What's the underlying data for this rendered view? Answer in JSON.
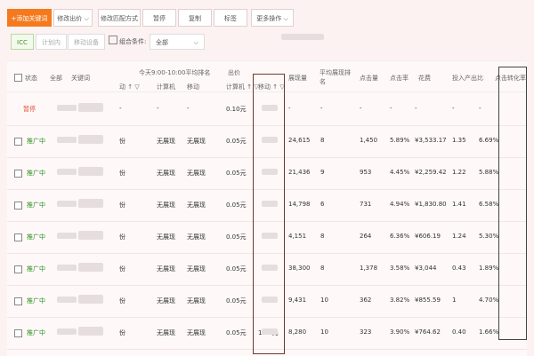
{
  "toolbar": {
    "add_keyword": "+添加关键词",
    "modify_bid": "修改出价",
    "modify_match": "修改匹配方式",
    "pause": "暂停",
    "copy": "复制",
    "tag": "标签",
    "more": "更多操作"
  },
  "filter": {
    "tabs": [
      "ICC",
      "计划内",
      "移动设备"
    ],
    "condition_label": "组合条件:",
    "condition_value": "全部"
  },
  "table": {
    "headers": {
      "status": "状态",
      "all": "全部",
      "keyword": "关键词",
      "rank_group": "今天9:00-10:00平均排名",
      "rank_mobile_left": "动 ↑ ▽",
      "rank_pc": "计算机",
      "rank_mobile": "移动",
      "bid_group": "出价",
      "bid_pc": "计算机 ↑ ▽",
      "bid_mobile": "移动 ↑ ▽",
      "impressions": "展现量",
      "avg_rank": "平均展现排名",
      "clicks": "点击量",
      "ctr": "点击率",
      "cost": "花费",
      "roi": "投入产出比",
      "conv": "点击转化率"
    },
    "rows": [
      {
        "status": "暂停",
        "status_type": "pause",
        "rank_mobile_left": "-",
        "rank_pc": "-",
        "rank_mobile": "-",
        "bid_pc": "0.10元",
        "bid_mobile": "",
        "impressions": "-",
        "avg_rank": "-",
        "clicks": "-",
        "ctr": "-",
        "cost": "-",
        "roi": "-",
        "conv": "-"
      },
      {
        "status": "推广中",
        "status_type": "on",
        "rank_mobile_left": "份",
        "rank_pc": "无展现",
        "rank_mobile": "无展现",
        "bid_pc": "0.05元",
        "bid_mobile": "",
        "impressions": "24,615",
        "avg_rank": "8",
        "clicks": "1,450",
        "ctr": "5.89%",
        "cost": "¥3,533.17",
        "roi": "1.35",
        "conv": "6.69%"
      },
      {
        "status": "推广中",
        "status_type": "on",
        "rank_mobile_left": "份",
        "rank_pc": "无展现",
        "rank_mobile": "无展现",
        "bid_pc": "0.05元",
        "bid_mobile": "",
        "impressions": "21,436",
        "avg_rank": "9",
        "clicks": "953",
        "ctr": "4.45%",
        "cost": "¥2,259.42",
        "roi": "1.22",
        "conv": "5.88%"
      },
      {
        "status": "推广中",
        "status_type": "on",
        "rank_mobile_left": "份",
        "rank_pc": "无展现",
        "rank_mobile": "无展现",
        "bid_pc": "0.05元",
        "bid_mobile": "",
        "impressions": "14,798",
        "avg_rank": "6",
        "clicks": "731",
        "ctr": "4.94%",
        "cost": "¥1,830.80",
        "roi": "1.41",
        "conv": "6.58%"
      },
      {
        "status": "推广中",
        "status_type": "on",
        "rank_mobile_left": "份",
        "rank_pc": "无展现",
        "rank_mobile": "无展现",
        "bid_pc": "0.05元",
        "bid_mobile": "",
        "impressions": "4,151",
        "avg_rank": "8",
        "clicks": "264",
        "ctr": "6.36%",
        "cost": "¥606.19",
        "roi": "1.24",
        "conv": "5.30%"
      },
      {
        "status": "推广中",
        "status_type": "on",
        "rank_mobile_left": "份",
        "rank_pc": "无展现",
        "rank_mobile": "无展现",
        "bid_pc": "0.05元",
        "bid_mobile": "",
        "impressions": "38,300",
        "avg_rank": "8",
        "clicks": "1,378",
        "ctr": "3.58%",
        "cost": "¥3,044",
        "roi": "0.43",
        "conv": "1.89%"
      },
      {
        "status": "推广中",
        "status_type": "on",
        "rank_mobile_left": "份",
        "rank_pc": "无展现",
        "rank_mobile": "无展现",
        "bid_pc": "0.05元",
        "bid_mobile": "",
        "impressions": "9,431",
        "avg_rank": "10",
        "clicks": "362",
        "ctr": "3.82%",
        "cost": "¥855.59",
        "roi": "1",
        "conv": "4.70%"
      },
      {
        "status": "推广中",
        "status_type": "on",
        "rank_mobile_left": "份",
        "rank_pc": "无展现",
        "rank_mobile": "无展现",
        "bid_pc": "0.05元",
        "bid_mobile": "1.65元",
        "impressions": "8,280",
        "avg_rank": "10",
        "clicks": "323",
        "ctr": "3.90%",
        "cost": "¥764.62",
        "roi": "0.40",
        "conv": "1.66%"
      }
    ]
  },
  "colors": {
    "primary": "#f57a1e",
    "status_on": "#2d8f1f",
    "status_pause": "#e14a2f"
  }
}
